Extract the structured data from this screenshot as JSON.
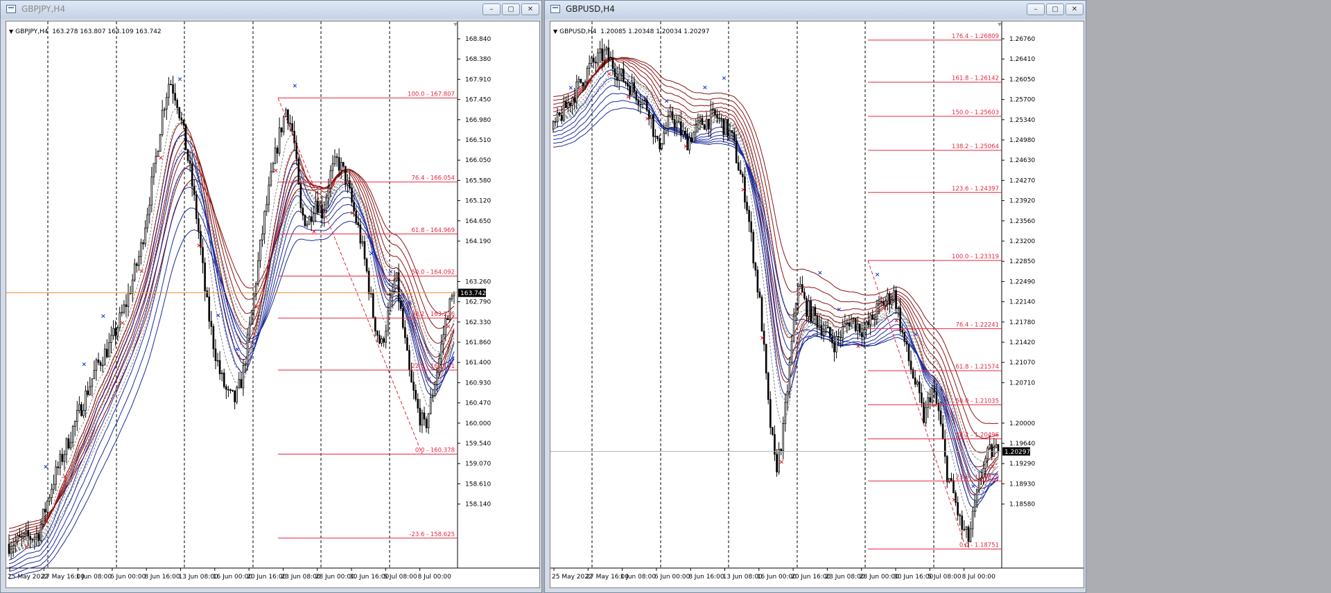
{
  "windows": [
    {
      "title": "GBPJPY,H4",
      "header": {
        "symbol": "GBPJPY,H4",
        "ohlc": "163.278 163.807 163.109 163.742"
      },
      "controls": {
        "minimize": "–",
        "maximize": "▢",
        "close": "✕"
      },
      "price_axis": [
        "168.840",
        "168.380",
        "167.910",
        "167.450",
        "166.980",
        "166.510",
        "166.050",
        "165.580",
        "165.120",
        "164.650",
        "164.190",
        "163.742",
        "163.260",
        "162.790",
        "162.330",
        "161.860",
        "161.400",
        "160.930",
        "160.470",
        "160.000",
        "159.540",
        "159.070",
        "158.610",
        "158.140"
      ],
      "current_price": "163.742",
      "time_axis": [
        "25 May 2022",
        "27 May 16:00",
        "1 Jun 08:00",
        "6 Jun 00:00",
        "8 Jun 16:00",
        "13 Jun 08:00",
        "16 Jun 00:00",
        "20 Jun 16:00",
        "23 Jun 08:00",
        "28 Jun 00:00",
        "30 Jun 16:00",
        "5 Jul 08:00",
        "8 Jul 00:00"
      ],
      "fib_levels": [
        "100.0 - 167.807",
        "76.4 - 166.054",
        "61.8 - 164.969",
        "50.0 - 164.092",
        "38.2 - 163.216",
        "23.6 - 162.131",
        "0.0 - 160.378",
        "-23.6 - 158.625"
      ]
    },
    {
      "title": "GBPUSD,H4",
      "header": {
        "symbol": "GBPUSD,H4",
        "ohlc": "1.20085 1.20348 1.20034 1.20297"
      },
      "controls": {
        "minimize": "–",
        "maximize": "▢",
        "close": "✕"
      },
      "price_axis": [
        "1.26760",
        "1.26410",
        "1.26050",
        "1.25700",
        "1.25340",
        "1.24980",
        "1.24630",
        "1.24270",
        "1.23920",
        "1.23560",
        "1.23200",
        "1.22850",
        "1.22490",
        "1.22140",
        "1.21780",
        "1.21420",
        "1.21070",
        "1.20710",
        "1.20297",
        "1.20000",
        "1.19640",
        "1.19290",
        "1.18930",
        "1.18580"
      ],
      "current_price": "1.20297",
      "time_axis": [
        "25 May 2022",
        "27 May 16:00",
        "1 Jun 08:00",
        "6 Jun 00:00",
        "8 Jun 16:00",
        "13 Jun 08:00",
        "16 Jun 00:00",
        "20 Jun 16:00",
        "23 Jun 08:00",
        "28 Jun 00:00",
        "30 Jun 16:00",
        "5 Jul 08:00",
        "8 Jul 00:00"
      ],
      "fib_levels": [
        "176.4 - 1.26809",
        "161.8 - 1.26142",
        "150.0 - 1.25603",
        "138.2 - 1.25064",
        "123.6 - 1.24397",
        "100.0 - 1.23319",
        "76.4 - 1.22241",
        "61.8 - 1.21574",
        "50.0 - 1.21035",
        "38.2 - 1.20496",
        "23.6 - 1.19829",
        "0.0 - 1.18751"
      ]
    }
  ],
  "chart_data": [
    {
      "type": "candlestick",
      "title": "GBPJPY,H4",
      "ylim": [
        158.0,
        169.2
      ],
      "x": [
        "25 May 2022",
        "27 May 16:00",
        "1 Jun 08:00",
        "6 Jun 00:00",
        "8 Jun 16:00",
        "13 Jun 08:00",
        "16 Jun 00:00",
        "20 Jun 16:00",
        "23 Jun 08:00",
        "28 Jun 00:00",
        "30 Jun 16:00",
        "5 Jul 08:00",
        "8 Jul 00:00"
      ],
      "price_path": [
        [
          0,
          158.5
        ],
        [
          4,
          158.7
        ],
        [
          6,
          159.8
        ],
        [
          9,
          161.0
        ],
        [
          12,
          162.2
        ],
        [
          14,
          162.7
        ],
        [
          16,
          163.5
        ],
        [
          18,
          164.6
        ],
        [
          20,
          166.4
        ],
        [
          21,
          167.5
        ],
        [
          22,
          168.2
        ],
        [
          23,
          167.8
        ],
        [
          24,
          167.0
        ],
        [
          25,
          166.1
        ],
        [
          26,
          165.0
        ],
        [
          27,
          163.6
        ],
        [
          28,
          162.7
        ],
        [
          29,
          162.0
        ],
        [
          30,
          161.6
        ],
        [
          31,
          161.5
        ],
        [
          32,
          162.0
        ],
        [
          33,
          163.0
        ],
        [
          34,
          164.2
        ],
        [
          35,
          165.3
        ],
        [
          36,
          166.2
        ],
        [
          37,
          167.0
        ],
        [
          38,
          167.6
        ],
        [
          39,
          167.0
        ],
        [
          40,
          165.4
        ],
        [
          41,
          165.2
        ],
        [
          42,
          165.7
        ],
        [
          43,
          165.4
        ],
        [
          44,
          166.2
        ],
        [
          45,
          166.5
        ],
        [
          46,
          166.2
        ],
        [
          47,
          165.6
        ],
        [
          48,
          165.0
        ],
        [
          49,
          164.2
        ],
        [
          50,
          163.2
        ],
        [
          51,
          162.6
        ],
        [
          52,
          163.3
        ],
        [
          53,
          164.1
        ],
        [
          54,
          163.0
        ],
        [
          55,
          161.9
        ],
        [
          56,
          161.3
        ],
        [
          57,
          160.9
        ],
        [
          58,
          161.6
        ],
        [
          59,
          162.4
        ],
        [
          60,
          163.3
        ],
        [
          61,
          163.742
        ]
      ],
      "last": 163.742,
      "fib_levels": [
        {
          "ratio": 100.0,
          "price": 167.807
        },
        {
          "ratio": 76.4,
          "price": 166.054
        },
        {
          "ratio": 61.8,
          "price": 164.969
        },
        {
          "ratio": 50.0,
          "price": 164.092
        },
        {
          "ratio": 38.2,
          "price": 163.216
        },
        {
          "ratio": 23.6,
          "price": 162.131
        },
        {
          "ratio": 0.0,
          "price": 160.378
        },
        {
          "ratio": -23.6,
          "price": 158.625
        }
      ]
    },
    {
      "type": "candlestick",
      "title": "GBPUSD,H4",
      "ylim": [
        1.1845,
        1.2695
      ],
      "x": [
        "25 May 2022",
        "27 May 16:00",
        "1 Jun 08:00",
        "6 Jun 00:00",
        "8 Jun 16:00",
        "13 Jun 08:00",
        "16 Jun 00:00",
        "20 Jun 16:00",
        "23 Jun 08:00",
        "28 Jun 00:00",
        "30 Jun 16:00",
        "5 Jul 08:00",
        "8 Jul 00:00"
      ],
      "price_path": [
        [
          0,
          1.254
        ],
        [
          3,
          1.26
        ],
        [
          5,
          1.264
        ],
        [
          7,
          1.266
        ],
        [
          9,
          1.2625
        ],
        [
          11,
          1.26
        ],
        [
          13,
          1.257
        ],
        [
          14,
          1.251
        ],
        [
          16,
          1.256
        ],
        [
          18,
          1.252
        ],
        [
          20,
          1.255
        ],
        [
          22,
          1.256
        ],
        [
          24,
          1.253
        ],
        [
          26,
          1.243
        ],
        [
          28,
          1.225
        ],
        [
          29,
          1.21
        ],
        [
          30,
          1.2
        ],
        [
          31,
          1.206
        ],
        [
          32,
          1.218
        ],
        [
          33,
          1.23
        ],
        [
          34,
          1.226
        ],
        [
          36,
          1.223
        ],
        [
          38,
          1.22
        ],
        [
          40,
          1.224
        ],
        [
          42,
          1.222
        ],
        [
          44,
          1.226
        ],
        [
          46,
          1.228
        ],
        [
          47,
          1.222
        ],
        [
          48,
          1.217
        ],
        [
          49,
          1.213
        ],
        [
          50,
          1.208
        ],
        [
          51,
          1.213
        ],
        [
          52,
          1.209
        ],
        [
          53,
          1.2
        ],
        [
          54,
          1.196
        ],
        [
          55,
          1.191
        ],
        [
          56,
          1.189
        ],
        [
          57,
          1.195
        ],
        [
          58,
          1.201
        ],
        [
          59,
          1.203
        ],
        [
          60,
          1.20297
        ]
      ],
      "last": 1.20297,
      "fib_levels": [
        {
          "ratio": 176.4,
          "price": 1.26809
        },
        {
          "ratio": 161.8,
          "price": 1.26142
        },
        {
          "ratio": 150.0,
          "price": 1.25603
        },
        {
          "ratio": 138.2,
          "price": 1.25064
        },
        {
          "ratio": 123.6,
          "price": 1.24397
        },
        {
          "ratio": 100.0,
          "price": 1.23319
        },
        {
          "ratio": 76.4,
          "price": 1.22241
        },
        {
          "ratio": 61.8,
          "price": 1.21574
        },
        {
          "ratio": 50.0,
          "price": 1.21035
        },
        {
          "ratio": 38.2,
          "price": 1.20496
        },
        {
          "ratio": 23.6,
          "price": 1.19829
        },
        {
          "ratio": 0.0,
          "price": 1.18751
        }
      ]
    }
  ],
  "colors": {
    "candle": "#000000",
    "fib": "#e5263f",
    "ribbon_red": "#8b1010",
    "ribbon_blue": "#1a2a9c",
    "ribbon_gray": "#888888",
    "marker": "#1a39d6",
    "signal": "#e02020",
    "current_line": "#e8913a"
  }
}
